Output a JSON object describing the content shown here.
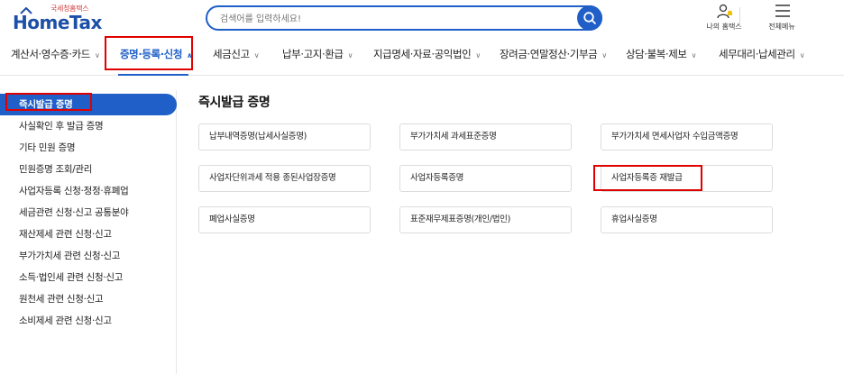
{
  "header": {
    "logo_sub": "국세청홈택스",
    "logo_main": "HomeTax",
    "search_placeholder": "검색어를 입력하세요!",
    "my_hometax_label": "나의 홈택스",
    "all_menu_label": "전체메뉴",
    "icons": {
      "search": "search-icon",
      "my": "user-bell-icon",
      "menu": "hamburger-icon"
    }
  },
  "nav": {
    "items": [
      {
        "label": "계산서·영수증·카드"
      },
      {
        "label": "증명·등록·신청",
        "active": true
      },
      {
        "label": "세금신고"
      },
      {
        "label": "납부·고지·환급"
      },
      {
        "label": "지급명세·자료·공익법인"
      },
      {
        "label": "장려금·연말정산·기부금"
      },
      {
        "label": "상담·불복·제보"
      },
      {
        "label": "세무대리·납세관리"
      }
    ]
  },
  "sidebar": {
    "items": [
      {
        "label": "즉시발급 증명",
        "active": true
      },
      {
        "label": "사실확인 후 발급 증명"
      },
      {
        "label": "기타 민원 증명"
      },
      {
        "label": "민원증명 조회/관리"
      },
      {
        "label": "사업자등록 신청·정정·휴폐업"
      },
      {
        "label": "세금관련 신청·신고 공통분야"
      },
      {
        "label": "재산제세 관련 신청·신고"
      },
      {
        "label": "부가가치세 관련 신청·신고"
      },
      {
        "label": "소득·법인세 관련 신청·신고"
      },
      {
        "label": "원천세 관련 신청·신고"
      },
      {
        "label": "소비제세 관련 신청·신고"
      }
    ]
  },
  "main": {
    "title": "즉시발급 증명",
    "cards": [
      {
        "label": "납부내역증명(납세사실증명)"
      },
      {
        "label": "부가가치세 과세표준증명"
      },
      {
        "label": "부가가치세 면세사업자 수입금액증명"
      },
      {
        "label": "사업자단위과세 적용 종된사업장증명"
      },
      {
        "label": "사업자등록증명"
      },
      {
        "label": "사업자등록증 재발급"
      },
      {
        "label": "폐업사실증명"
      },
      {
        "label": "표준재무제표증명(개인/법인)"
      },
      {
        "label": "휴업사실증명"
      }
    ]
  },
  "colors": {
    "brand": "#1f5fc7",
    "highlight": "#e00000",
    "logo": "#1c4fa8"
  }
}
